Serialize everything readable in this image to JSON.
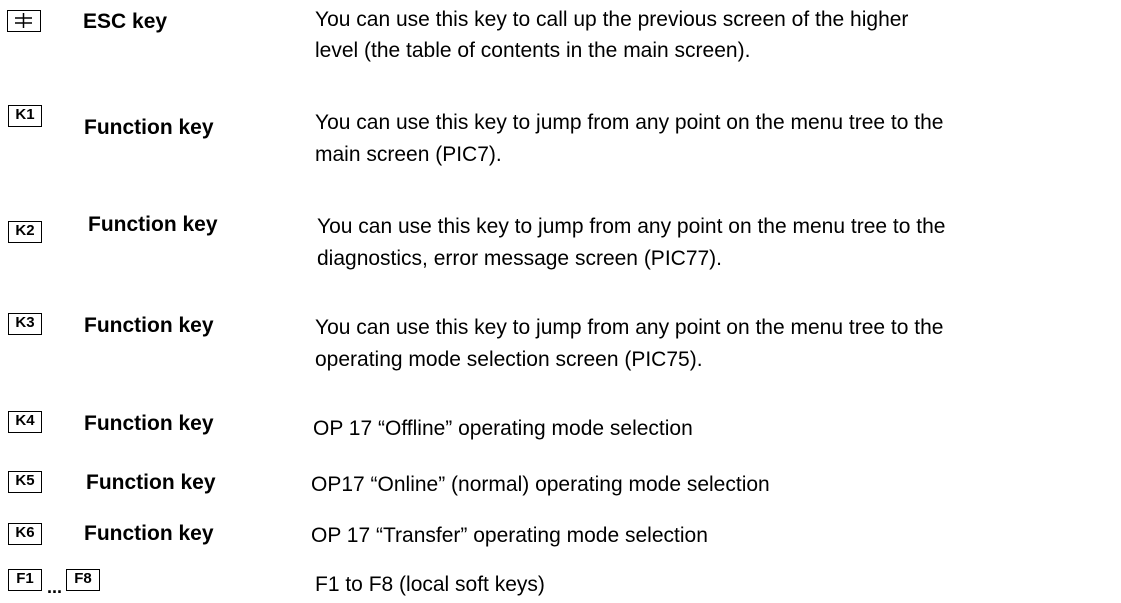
{
  "rows": [
    {
      "key_label": "",
      "key_icon": "escape-symbol-icon",
      "name": "ESC key",
      "desc_lines": [
        "You can use this key to call up the previous screen of the higher",
        "level (the table of contents in the main screen)."
      ]
    },
    {
      "key_label": "K1",
      "name": "Function key",
      "desc_lines": [
        "You can use this key to jump from any point on the menu tree to the",
        "main screen (PIC7)."
      ]
    },
    {
      "key_label": "K2",
      "name": "Function key",
      "desc_lines": [
        "You can use this key to jump from any point on the menu tree to the",
        "diagnostics, error message screen (PIC77)."
      ]
    },
    {
      "key_label": "K3",
      "name": "Function key",
      "desc_lines": [
        "You can use this key to jump from any point on the menu tree to the",
        "operating mode selection screen (PIC75)."
      ]
    },
    {
      "key_label": "K4",
      "name": "Function key",
      "desc_lines": [
        "OP 17 “Offline” operating mode selection"
      ]
    },
    {
      "key_label": "K5",
      "name": "Function key",
      "desc_lines": [
        "OP17 “Online” (normal) operating mode selection"
      ]
    },
    {
      "key_label": "K6",
      "name": "Function key",
      "desc_lines": [
        "OP 17 “Transfer” operating mode selection"
      ]
    },
    {
      "key_label_start": "F1",
      "ellipsis": "...",
      "key_label_end": "F8",
      "desc_lines": [
        "F1 to F8 (local soft keys)"
      ]
    }
  ]
}
